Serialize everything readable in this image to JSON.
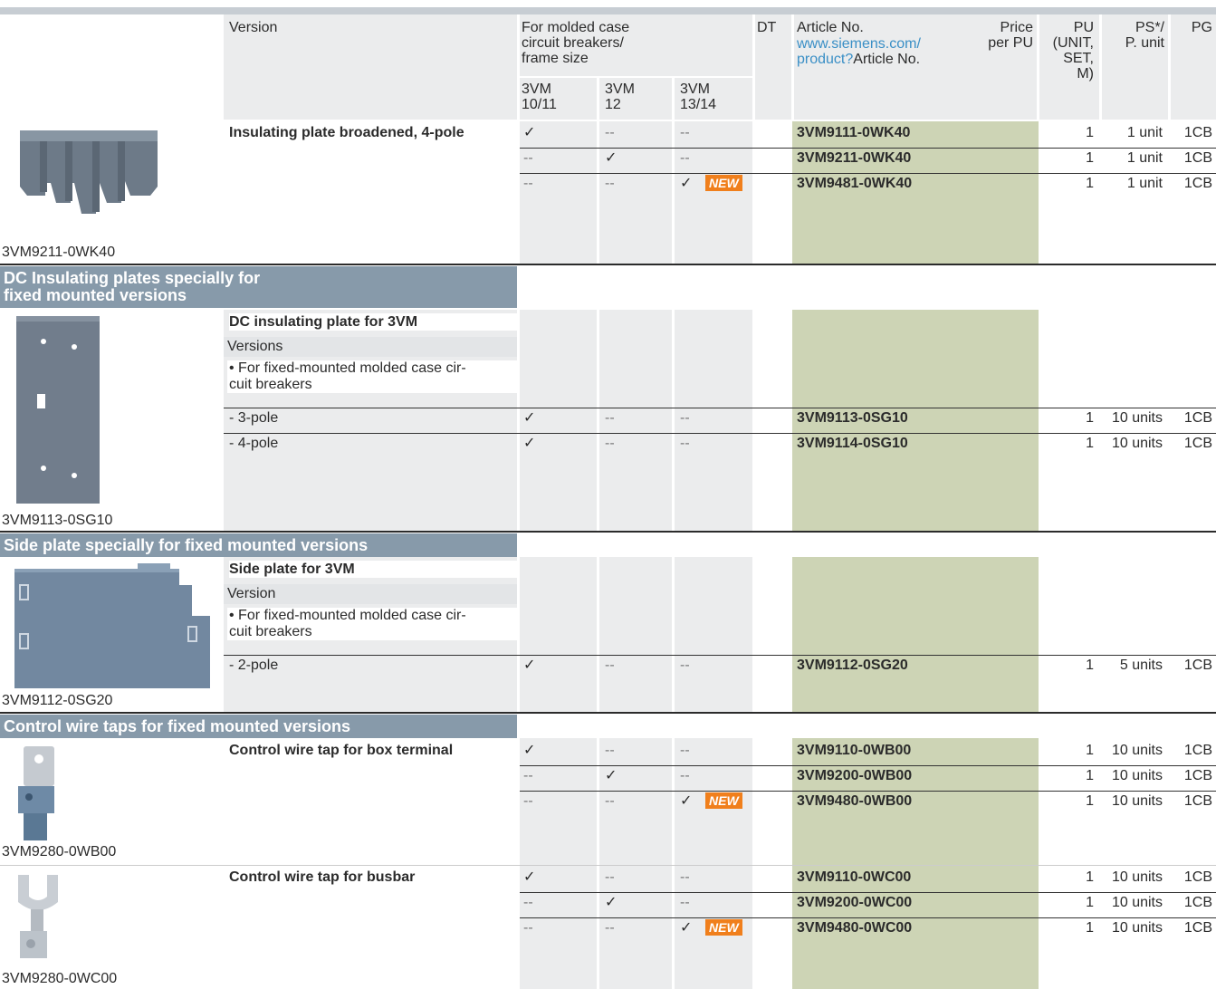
{
  "header": {
    "version": "Version",
    "for_mccb": "For molded case\ncircuit breakers/\nframe size",
    "sub1": "3VM\n10/11",
    "sub2": "3VM\n12",
    "sub3": "3VM\n13/14",
    "dt": "DT",
    "article_no": "Article No.",
    "article_link": "www.siemens.com/\nproduct?",
    "article_link_suffix": "Article No.",
    "price": "Price\nper PU",
    "pu": "PU\n(UNIT,\nSET,\nM)",
    "ps": "PS*/\nP. unit",
    "pg": "PG"
  },
  "sections": {
    "dc_title": "DC Insulating plates specially for\nfixed mounted versions",
    "side_title": "Side plate specially for fixed mounted versions",
    "wire_title": "Control wire taps for fixed mounted versions"
  },
  "blocks": {
    "insulating": {
      "caption": "3VM9211-0WK40",
      "title": "Insulating plate broadened, 4-pole",
      "rows": [
        {
          "c1": "✓",
          "c2": "--",
          "c3": "--",
          "new": "",
          "article": "3VM9111-0WK40",
          "pu": "1",
          "ps": "1 unit",
          "pg": "1CB"
        },
        {
          "c1": "--",
          "c2": "✓",
          "c3": "--",
          "new": "",
          "article": "3VM9211-0WK40",
          "pu": "1",
          "ps": "1 unit",
          "pg": "1CB"
        },
        {
          "c1": "--",
          "c2": "--",
          "c3": "✓",
          "new": "NEW",
          "article": "3VM9481-0WK40",
          "pu": "1",
          "ps": "1 unit",
          "pg": "1CB"
        }
      ]
    },
    "dc": {
      "caption": "3VM9113-0SG10",
      "title": "DC insulating plate for 3VM",
      "versions": "Versions",
      "bullet": "• For fixed-mounted molded case cir-\n   cuit breakers",
      "rows": [
        {
          "label": "- 3-pole",
          "c1": "✓",
          "c2": "--",
          "c3": "--",
          "article": "3VM9113-0SG10",
          "pu": "1",
          "ps": "10 units",
          "pg": "1CB"
        },
        {
          "label": "- 4-pole",
          "c1": "✓",
          "c2": "--",
          "c3": "--",
          "article": "3VM9114-0SG10",
          "pu": "1",
          "ps": "10 units",
          "pg": "1CB"
        }
      ]
    },
    "side": {
      "caption": "3VM9112-0SG20",
      "title": "Side plate for 3VM",
      "versions": "Version",
      "bullet": "• For fixed-mounted molded case cir-\n   cuit breakers",
      "rows": [
        {
          "label": "- 2-pole",
          "c1": "✓",
          "c2": "--",
          "c3": "--",
          "article": "3VM9112-0SG20",
          "pu": "1",
          "ps": "5 units",
          "pg": "1CB"
        }
      ]
    },
    "box": {
      "caption": "3VM9280-0WB00",
      "title": "Control wire tap for box terminal",
      "rows": [
        {
          "c1": "✓",
          "c2": "--",
          "c3": "--",
          "new": "",
          "article": "3VM9110-0WB00",
          "pu": "1",
          "ps": "10 units",
          "pg": "1CB"
        },
        {
          "c1": "--",
          "c2": "✓",
          "c3": "--",
          "new": "",
          "article": "3VM9200-0WB00",
          "pu": "1",
          "ps": "10 units",
          "pg": "1CB"
        },
        {
          "c1": "--",
          "c2": "--",
          "c3": "✓",
          "new": "NEW",
          "article": "3VM9480-0WB00",
          "pu": "1",
          "ps": "10 units",
          "pg": "1CB"
        }
      ]
    },
    "busbar": {
      "caption": "3VM9280-0WC00",
      "title": "Control wire tap for busbar",
      "rows": [
        {
          "c1": "✓",
          "c2": "--",
          "c3": "--",
          "new": "",
          "article": "3VM9110-0WC00",
          "pu": "1",
          "ps": "10 units",
          "pg": "1CB"
        },
        {
          "c1": "--",
          "c2": "✓",
          "c3": "--",
          "new": "",
          "article": "3VM9200-0WC00",
          "pu": "1",
          "ps": "10 units",
          "pg": "1CB"
        },
        {
          "c1": "--",
          "c2": "--",
          "c3": "✓",
          "new": "NEW",
          "article": "3VM9480-0WC00",
          "pu": "1",
          "ps": "10 units",
          "pg": "1CB"
        }
      ]
    }
  },
  "colors": {
    "section_bg": "#879aaa",
    "article_bg": "#cdd4b5",
    "column_bg": "#ebeced",
    "new_badge": "#f07f1c",
    "link": "#3a8fc6"
  }
}
